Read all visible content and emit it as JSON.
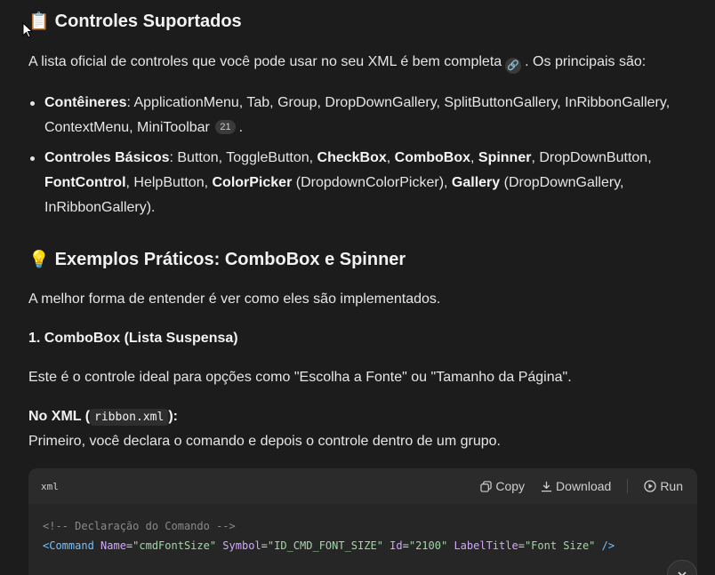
{
  "section1": {
    "icon": "clipboard-icon",
    "title": "Controles Suportados",
    "intro": "A lista oficial de controles que você pode usar no seu XML é bem completa",
    "intro_suffix": ". Os principais são:",
    "bullets": [
      {
        "label": "Contêineres",
        "text": ": ApplicationMenu, Tab, Group, DropDownGallery, SplitButtonGallery, InRibbonGallery, ContextMenu, MiniToolbar",
        "badge": "21",
        "suffix": "."
      },
      {
        "label": "Controles Básicos",
        "t1": ": Button, ToggleButton, ",
        "b1": "CheckBox",
        "t2": ", ",
        "b2": "ComboBox",
        "t3": ", ",
        "b3": "Spinner",
        "t4": ", DropDownButton, ",
        "b4": "FontControl",
        "t5": ", HelpButton, ",
        "b5": "ColorPicker",
        "t6": " (DropdownColorPicker), ",
        "b6": "Gallery",
        "t7": " (DropDownGallery, InRibbonGallery)."
      }
    ]
  },
  "section2": {
    "icon": "lightbulb-icon",
    "title": "Exemplos Práticos: ComboBox e Spinner",
    "intro": "A melhor forma de entender é ver como eles são implementados.",
    "subheading": "1. ComboBox (Lista Suspensa)",
    "desc": "Este é o controle ideal para opções como \"Escolha a Fonte\" ou \"Tamanho da Página\".",
    "xml_label_prefix": "No XML (",
    "xml_file": "ribbon.xml",
    "xml_label_suffix": "):",
    "xml_desc": "Primeiro, você declara o comando e depois o controle dentro de um grupo."
  },
  "codeblock": {
    "lang": "xml",
    "copy": "Copy",
    "download": "Download",
    "run": "Run",
    "line1": "<!-- Declaração do Comando -->",
    "line2": {
      "open": "<Command",
      "a1": " Name",
      "v1": "\"cmdFontSize\"",
      "a2": " Symbol",
      "v2": "\"ID_CMD_FONT_SIZE\"",
      "a3": " Id",
      "v3": "\"2100\"",
      "a4": " LabelTitle",
      "v4": "\"Font Size\"",
      "close": " />"
    }
  },
  "colors": {
    "background": "#1c1c1c",
    "code_bg": "#262626",
    "text": "#e6e6e6"
  }
}
